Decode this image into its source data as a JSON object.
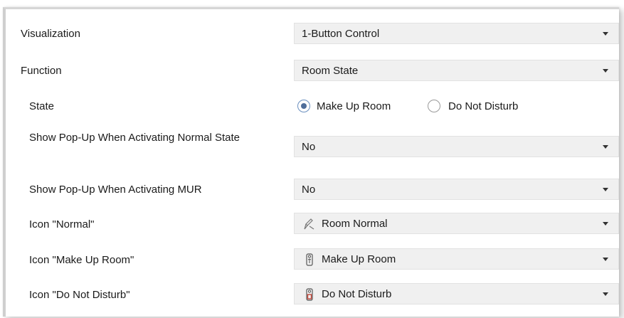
{
  "rows": {
    "visualization": {
      "label": "Visualization",
      "value": "1-Button Control"
    },
    "function": {
      "label": "Function",
      "value": "Room State"
    },
    "state": {
      "label": "State",
      "options": [
        {
          "label": "Make Up Room",
          "checked": true
        },
        {
          "label": "Do Not Disturb",
          "checked": false
        }
      ]
    },
    "popup_normal": {
      "label": "Show Pop-Up When Activating Normal State",
      "value": "No"
    },
    "popup_mur": {
      "label": "Show Pop-Up When Activating MUR",
      "value": "No"
    },
    "icon_normal": {
      "label": "Icon \"Normal\"",
      "value": "Room Normal",
      "icon": "room-normal-icon"
    },
    "icon_mur": {
      "label": "Icon \"Make Up Room\"",
      "value": "Make Up Room",
      "icon": "make-up-room-icon"
    },
    "icon_dnd": {
      "label": "Icon \"Do Not Disturb\"",
      "value": "Do Not Disturb",
      "icon": "do-not-disturb-icon"
    }
  },
  "colors": {
    "accent": "#4f6d9a",
    "dnd_icon": "#c0392b"
  }
}
